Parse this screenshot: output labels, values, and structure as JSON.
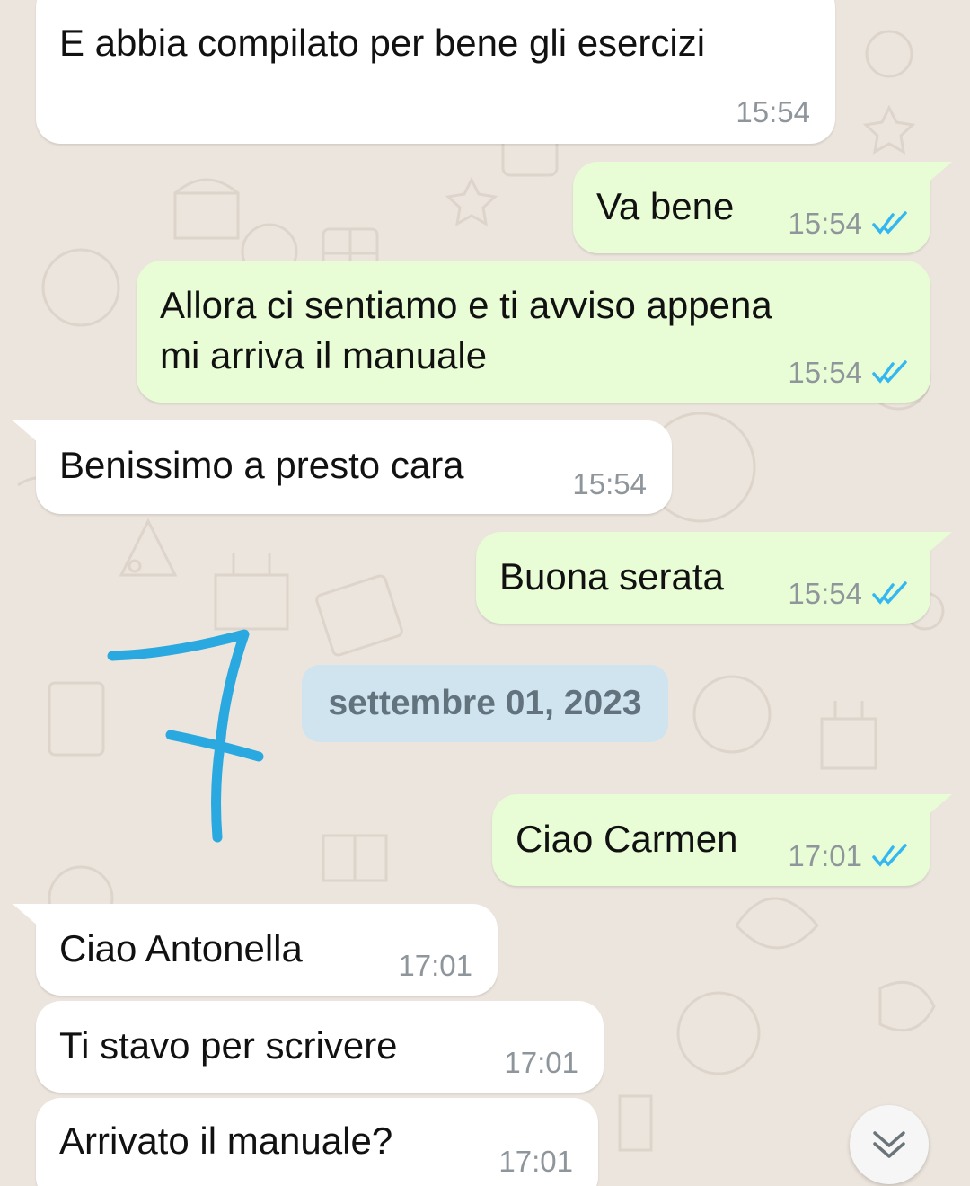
{
  "messages": [
    {
      "direction": "in",
      "text": "E abbia compilato per bene gli esercizi",
      "time": "15:54"
    },
    {
      "direction": "out",
      "text": "Va bene",
      "time": "15:54",
      "status": "read"
    },
    {
      "direction": "out",
      "text": "Allora ci sentiamo e ti avviso appena\nmi arriva il manuale",
      "time": "15:54",
      "status": "read"
    },
    {
      "direction": "in",
      "text": "Benissimo a presto cara",
      "time": "15:54"
    },
    {
      "direction": "out",
      "text": "Buona serata",
      "time": "15:54",
      "status": "read"
    },
    {
      "direction": "out",
      "text": "Ciao Carmen",
      "time": "17:01",
      "status": "read"
    },
    {
      "direction": "in",
      "text": "Ciao Antonella",
      "time": "17:01"
    },
    {
      "direction": "in",
      "text": "Ti stavo per scrivere",
      "time": "17:01"
    },
    {
      "direction": "in",
      "text": "Arrivato il manuale?",
      "time": "17:01"
    }
  ],
  "date_divider": "settembre 01, 2023",
  "icons": {
    "read_receipt": "double-check-icon",
    "scroll_down": "double-chevron-down-icon"
  },
  "colors": {
    "background": "#ece5dd",
    "incoming_bubble": "#ffffff",
    "outgoing_bubble": "#e8fcd6",
    "read_tick": "#34b7f1",
    "date_chip": "#cfe4ef",
    "scribble": "#2aa8e0"
  }
}
